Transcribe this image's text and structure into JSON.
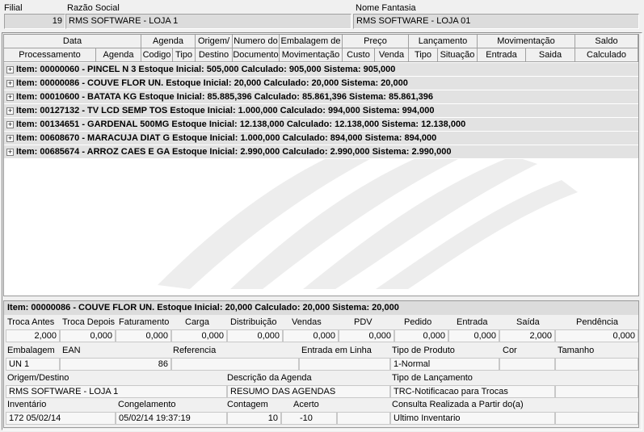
{
  "top": {
    "filial_label": "Filial",
    "filial_value": "19",
    "razao_label": "Razão Social",
    "razao_value": "RMS SOFTWARE - LOJA 1",
    "fantasia_label": "Nome Fantasia",
    "fantasia_value": "RMS SOFTWARE - LOJA 01"
  },
  "grid": {
    "groups": [
      "Data",
      "Agenda",
      "Origem/",
      "Numero do",
      "Embalagem de",
      "Preço",
      "Lançamento",
      "Movimentação",
      "Saldo"
    ],
    "subs": [
      "Processamento",
      "Agenda",
      "Codigo",
      "Tipo",
      "Destino",
      "Documento",
      "Movimentação",
      "Custo",
      "Venda",
      "Tipo",
      "Situação",
      "Entrada",
      "Saida",
      "Calculado"
    ],
    "rows": [
      "Item: 00000060 - PINCEL N 3  Estoque Inicial: 505,000  Calculado: 905,000  Sistema: 905,000",
      "Item: 00000086 - COUVE FLOR UN.  Estoque Inicial: 20,000  Calculado: 20,000  Sistema: 20,000",
      "Item: 00010600 - BATATA KG  Estoque Inicial: 85.885,396  Calculado: 85.861,396  Sistema: 85.861,396",
      "Item: 00127132 - TV LCD SEMP TOS  Estoque Inicial: 1.000,000  Calculado: 994,000  Sistema: 994,000",
      "Item: 00134651 - GARDENAL 500MG  Estoque Inicial: 12.138,000  Calculado: 12.138,000  Sistema: 12.138,000",
      "Item: 00608670 - MARACUJA DIAT G  Estoque Inicial: 1.000,000  Calculado: 894,000  Sistema: 894,000",
      "Item: 00685674 - ARROZ CAES E GA  Estoque Inicial: 2.990,000  Calculado: 2.990,000  Sistema: 2.990,000"
    ]
  },
  "detail": {
    "title": "Item: 00000086 - COUVE FLOR UN.  Estoque Inicial: 20,000  Calculado: 20,000  Sistema: 20,000",
    "metric_labels": [
      "Troca Antes",
      "Troca Depois",
      "Faturamento",
      "Carga",
      "Distribuição",
      "Vendas",
      "PDV",
      "Pedido",
      "Entrada",
      "Saída",
      "Pendência"
    ],
    "metric_values": [
      "2,000",
      "0,000",
      "0,000",
      "0,000",
      "0,000",
      "0,000",
      "0,000",
      "0,000",
      "0,000",
      "2,000",
      "0,000"
    ],
    "embalagem_label": "Embalagem",
    "embalagem_value": "UN   1",
    "ean_label": "EAN",
    "ean_value": "86",
    "referencia_label": "Referencia",
    "referencia_value": "",
    "entrada_linha_label": "Entrada em Linha",
    "entrada_linha_value": "",
    "tipo_produto_label": "Tipo de Produto",
    "tipo_produto_value": "1-Normal",
    "cor_label": "Cor",
    "cor_value": "",
    "tamanho_label": "Tamanho",
    "tamanho_value": "",
    "origem_label": "Origem/Destino",
    "origem_value": "RMS SOFTWARE - LOJA 1",
    "desc_agenda_label": "Descrição da Agenda",
    "desc_agenda_value": "RESUMO DAS AGENDAS",
    "tipo_lanc_label": "Tipo de Lançamento",
    "tipo_lanc_value": "TRC-Notificacao para Trocas",
    "inventario_label": "Inventário",
    "inventario_value": "172 05/02/14",
    "congelamento_label": "Congelamento",
    "congelamento_value": "05/02/14 19:37:19",
    "contagem_label": "Contagem",
    "contagem_value": "10",
    "acerto_label": "Acerto",
    "acerto_value": "-10",
    "consulta_label": "Consulta Realizada a Partir do(a)",
    "consulta_value": "Ultimo Inventario"
  }
}
